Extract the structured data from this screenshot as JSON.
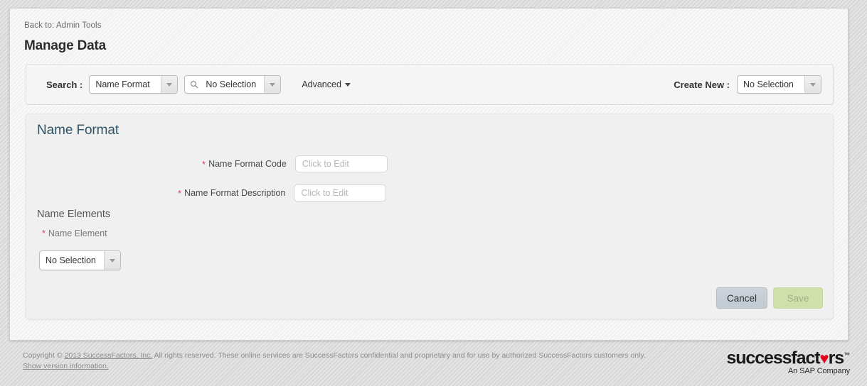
{
  "header": {
    "back_link": "Back to: Admin Tools",
    "page_title": "Manage Data"
  },
  "toolbar": {
    "search_label": "Search :",
    "object_dropdown": {
      "value": "Name Format",
      "icon": "chevron-down-icon"
    },
    "record_dropdown": {
      "value": "No Selection",
      "search_icon": "search-icon",
      "icon": "chevron-down-icon"
    },
    "advanced_label": "Advanced",
    "create_new_label": "Create New :",
    "create_new_dropdown": {
      "value": "No Selection",
      "icon": "chevron-down-icon"
    }
  },
  "panel": {
    "heading": "Name Format",
    "fields": [
      {
        "required_marker": "*",
        "label": "Name Format Code",
        "placeholder": "Click to Edit",
        "value": ""
      },
      {
        "required_marker": "*",
        "label": "Name Format Description",
        "placeholder": "Click to Edit",
        "value": ""
      }
    ],
    "section": {
      "heading": "Name Elements",
      "required_marker": "*",
      "sub_label": "Name Element",
      "element_dropdown": {
        "value": "No Selection",
        "icon": "chevron-down-icon"
      }
    },
    "actions": {
      "cancel_label": "Cancel",
      "save_label": "Save"
    }
  },
  "footer": {
    "copyright_prefix": "Copyright © ",
    "copyright_link": "2013 SuccessFactors, Inc.",
    "copyright_suffix": " All rights reserved. These online services are SuccessFactors confidential and proprietary and for use by authorized SuccessFactors customers only.",
    "version_link": "Show version information."
  },
  "logo": {
    "word_part1": "successfact",
    "word_heart": "♥",
    "word_part2": "rs",
    "trademark": "™",
    "tagline": "An SAP Company"
  },
  "colors": {
    "accent_heading": "#2f5468",
    "required_star": "#d0455c",
    "save_button": "#cfe0ab",
    "cancel_button": "#c6ced6",
    "logo_heart": "#e2001a"
  }
}
